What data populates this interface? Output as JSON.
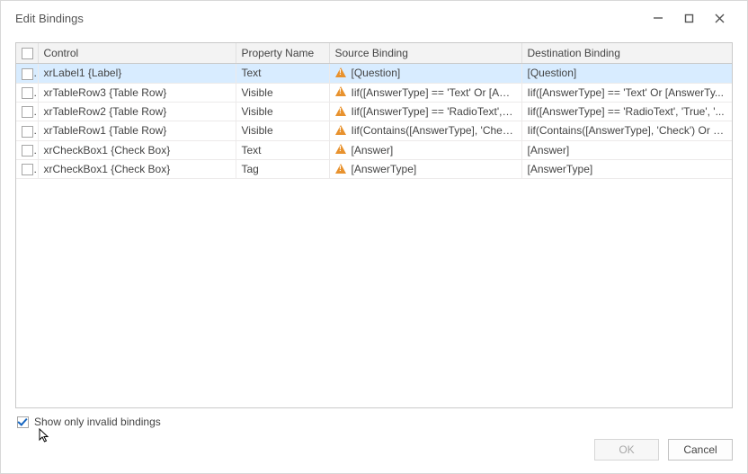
{
  "window": {
    "title": "Edit Bindings"
  },
  "columns": {
    "control": "Control",
    "property": "Property Name",
    "source": "Source Binding",
    "destination": "Destination Binding"
  },
  "rows": [
    {
      "selected": true,
      "control": "xrLabel1 {Label}",
      "property": "Text",
      "warn": true,
      "source": "[Question]",
      "destination": "[Question]"
    },
    {
      "selected": false,
      "control": "xrTableRow3 {Table Row}",
      "property": "Visible",
      "warn": true,
      "source": "Iif([AnswerType] == 'Text' Or [Answ...",
      "destination": "Iif([AnswerType] == 'Text' Or [AnswerTy..."
    },
    {
      "selected": false,
      "control": "xrTableRow2 {Table Row}",
      "property": "Visible",
      "warn": true,
      "source": "Iif([AnswerType] == 'RadioText', 'Tr...",
      "destination": "Iif([AnswerType] == 'RadioText', 'True', '..."
    },
    {
      "selected": false,
      "control": "xrTableRow1 {Table Row}",
      "property": "Visible",
      "warn": true,
      "source": "Iif(Contains([AnswerType], 'Check') ...",
      "destination": "Iif(Contains([AnswerType], 'Check') Or C..."
    },
    {
      "selected": false,
      "control": "xrCheckBox1 {Check Box}",
      "property": "Text",
      "warn": true,
      "source": "[Answer]",
      "destination": "[Answer]"
    },
    {
      "selected": false,
      "control": "xrCheckBox1 {Check Box}",
      "property": "Tag",
      "warn": true,
      "source": "[AnswerType]",
      "destination": "[AnswerType]"
    }
  ],
  "footer": {
    "show_only_invalid": "Show only invalid bindings",
    "show_only_invalid_checked": true
  },
  "buttons": {
    "ok": "OK",
    "cancel": "Cancel"
  }
}
